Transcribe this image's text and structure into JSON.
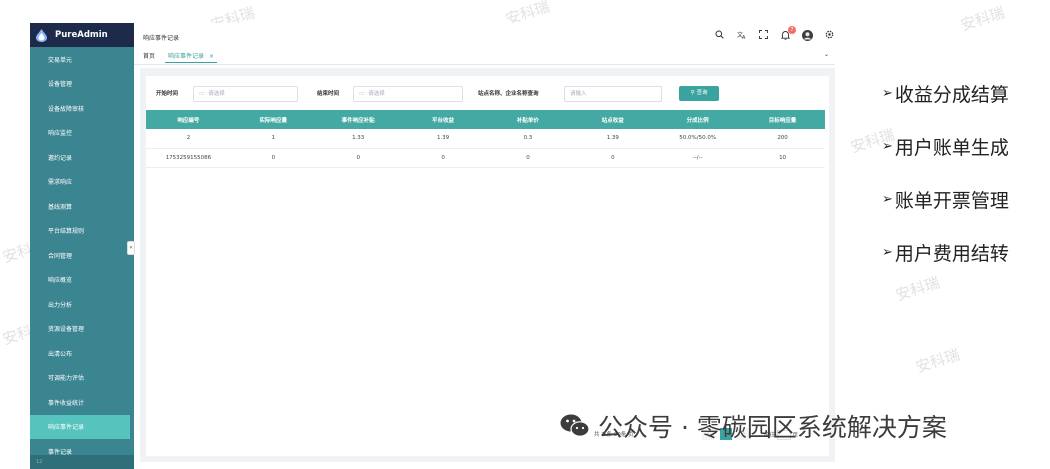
{
  "sidebar": {
    "brand": "PureAdmin",
    "items": [
      {
        "label": "交易单元"
      },
      {
        "label": "设备管理"
      },
      {
        "label": "设备故障审核"
      },
      {
        "label": "响应监控"
      },
      {
        "label": "邀约记录"
      },
      {
        "label": "需求响应"
      },
      {
        "label": "基线测算"
      },
      {
        "label": "平台结算规则"
      },
      {
        "label": "合同管理"
      },
      {
        "label": "响应概览"
      },
      {
        "label": "出力分析"
      },
      {
        "label": "资源设备管理"
      },
      {
        "label": "出清公布"
      },
      {
        "label": "可调能力评估"
      },
      {
        "label": "事件收益统计"
      },
      {
        "label": "响应事件记录"
      },
      {
        "label": "事件记录"
      }
    ],
    "active_index": 15,
    "footer": "12"
  },
  "header": {
    "breadcrumb": "响应事件记录",
    "notification_count": "7"
  },
  "tabs": {
    "home": "首页",
    "active": "响应事件记录",
    "close": "×"
  },
  "filters": {
    "start_label": "开始时间",
    "start_placeholder": "请选择",
    "end_label": "结束时间",
    "end_placeholder": "请选择",
    "site_label": "站点名称、企业名称查询",
    "site_placeholder": "请输入",
    "query_button": "查询"
  },
  "table": {
    "columns": [
      "响应编号",
      "实际响应量",
      "事件响应补贴",
      "平台收益",
      "补贴单价",
      "站点收益",
      "分成比例",
      "目标响应量"
    ],
    "rows": [
      [
        "2",
        "1",
        "1.33",
        "1.39",
        "0.3",
        "1.39",
        "50.0%/50.0%",
        "200"
      ],
      [
        "1753259155086",
        "0",
        "0",
        "0",
        "0",
        "0",
        "--/--",
        "10"
      ]
    ]
  },
  "pagination": {
    "total": "共 2 条",
    "page_size": "20条/页",
    "current_page": "1",
    "goto_label": "前往",
    "page_unit": "页"
  },
  "bullets": [
    {
      "label": "收益分成结算"
    },
    {
      "label": "用户账单生成"
    },
    {
      "label": "账单开票管理"
    },
    {
      "label": "用户费用结转"
    }
  ],
  "caption": {
    "text": "公众号 · 零碳园区系统解决方案"
  },
  "watermark": {
    "text": "安科瑞"
  },
  "colors": {
    "sidebar": "#3b8591",
    "sidebar_header": "#1e2a4a",
    "sidebar_active": "#57c3bd",
    "accent": "#3aa3a0",
    "table_header": "#44a8a3",
    "badge": "#f56c6c"
  }
}
